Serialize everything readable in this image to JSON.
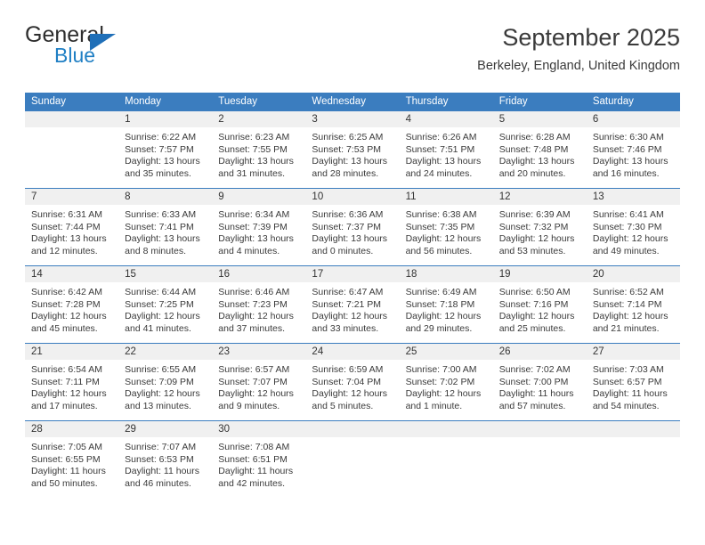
{
  "brand": {
    "name_part1": "General",
    "name_part2": "Blue",
    "logo_icon": "blue-triangle-icon"
  },
  "header": {
    "title": "September 2025",
    "location": "Berkeley, England, United Kingdom"
  },
  "colors": {
    "header_blue": "#3b7dbf",
    "brand_blue": "#1f7fc4",
    "daynum_band": "#f0f0f0",
    "text": "#3a3a3a"
  },
  "calendar": {
    "weekdays": [
      "Sunday",
      "Monday",
      "Tuesday",
      "Wednesday",
      "Thursday",
      "Friday",
      "Saturday"
    ],
    "weeks": [
      [
        {
          "day": "",
          "empty": true,
          "sunrise": "",
          "sunset": "",
          "daylight_a": "",
          "daylight_b": ""
        },
        {
          "day": "1",
          "sunrise": "Sunrise: 6:22 AM",
          "sunset": "Sunset: 7:57 PM",
          "daylight_a": "Daylight: 13 hours",
          "daylight_b": "and 35 minutes."
        },
        {
          "day": "2",
          "sunrise": "Sunrise: 6:23 AM",
          "sunset": "Sunset: 7:55 PM",
          "daylight_a": "Daylight: 13 hours",
          "daylight_b": "and 31 minutes."
        },
        {
          "day": "3",
          "sunrise": "Sunrise: 6:25 AM",
          "sunset": "Sunset: 7:53 PM",
          "daylight_a": "Daylight: 13 hours",
          "daylight_b": "and 28 minutes."
        },
        {
          "day": "4",
          "sunrise": "Sunrise: 6:26 AM",
          "sunset": "Sunset: 7:51 PM",
          "daylight_a": "Daylight: 13 hours",
          "daylight_b": "and 24 minutes."
        },
        {
          "day": "5",
          "sunrise": "Sunrise: 6:28 AM",
          "sunset": "Sunset: 7:48 PM",
          "daylight_a": "Daylight: 13 hours",
          "daylight_b": "and 20 minutes."
        },
        {
          "day": "6",
          "sunrise": "Sunrise: 6:30 AM",
          "sunset": "Sunset: 7:46 PM",
          "daylight_a": "Daylight: 13 hours",
          "daylight_b": "and 16 minutes."
        }
      ],
      [
        {
          "day": "7",
          "sunrise": "Sunrise: 6:31 AM",
          "sunset": "Sunset: 7:44 PM",
          "daylight_a": "Daylight: 13 hours",
          "daylight_b": "and 12 minutes."
        },
        {
          "day": "8",
          "sunrise": "Sunrise: 6:33 AM",
          "sunset": "Sunset: 7:41 PM",
          "daylight_a": "Daylight: 13 hours",
          "daylight_b": "and 8 minutes."
        },
        {
          "day": "9",
          "sunrise": "Sunrise: 6:34 AM",
          "sunset": "Sunset: 7:39 PM",
          "daylight_a": "Daylight: 13 hours",
          "daylight_b": "and 4 minutes."
        },
        {
          "day": "10",
          "sunrise": "Sunrise: 6:36 AM",
          "sunset": "Sunset: 7:37 PM",
          "daylight_a": "Daylight: 13 hours",
          "daylight_b": "and 0 minutes."
        },
        {
          "day": "11",
          "sunrise": "Sunrise: 6:38 AM",
          "sunset": "Sunset: 7:35 PM",
          "daylight_a": "Daylight: 12 hours",
          "daylight_b": "and 56 minutes."
        },
        {
          "day": "12",
          "sunrise": "Sunrise: 6:39 AM",
          "sunset": "Sunset: 7:32 PM",
          "daylight_a": "Daylight: 12 hours",
          "daylight_b": "and 53 minutes."
        },
        {
          "day": "13",
          "sunrise": "Sunrise: 6:41 AM",
          "sunset": "Sunset: 7:30 PM",
          "daylight_a": "Daylight: 12 hours",
          "daylight_b": "and 49 minutes."
        }
      ],
      [
        {
          "day": "14",
          "sunrise": "Sunrise: 6:42 AM",
          "sunset": "Sunset: 7:28 PM",
          "daylight_a": "Daylight: 12 hours",
          "daylight_b": "and 45 minutes."
        },
        {
          "day": "15",
          "sunrise": "Sunrise: 6:44 AM",
          "sunset": "Sunset: 7:25 PM",
          "daylight_a": "Daylight: 12 hours",
          "daylight_b": "and 41 minutes."
        },
        {
          "day": "16",
          "sunrise": "Sunrise: 6:46 AM",
          "sunset": "Sunset: 7:23 PM",
          "daylight_a": "Daylight: 12 hours",
          "daylight_b": "and 37 minutes."
        },
        {
          "day": "17",
          "sunrise": "Sunrise: 6:47 AM",
          "sunset": "Sunset: 7:21 PM",
          "daylight_a": "Daylight: 12 hours",
          "daylight_b": "and 33 minutes."
        },
        {
          "day": "18",
          "sunrise": "Sunrise: 6:49 AM",
          "sunset": "Sunset: 7:18 PM",
          "daylight_a": "Daylight: 12 hours",
          "daylight_b": "and 29 minutes."
        },
        {
          "day": "19",
          "sunrise": "Sunrise: 6:50 AM",
          "sunset": "Sunset: 7:16 PM",
          "daylight_a": "Daylight: 12 hours",
          "daylight_b": "and 25 minutes."
        },
        {
          "day": "20",
          "sunrise": "Sunrise: 6:52 AM",
          "sunset": "Sunset: 7:14 PM",
          "daylight_a": "Daylight: 12 hours",
          "daylight_b": "and 21 minutes."
        }
      ],
      [
        {
          "day": "21",
          "sunrise": "Sunrise: 6:54 AM",
          "sunset": "Sunset: 7:11 PM",
          "daylight_a": "Daylight: 12 hours",
          "daylight_b": "and 17 minutes."
        },
        {
          "day": "22",
          "sunrise": "Sunrise: 6:55 AM",
          "sunset": "Sunset: 7:09 PM",
          "daylight_a": "Daylight: 12 hours",
          "daylight_b": "and 13 minutes."
        },
        {
          "day": "23",
          "sunrise": "Sunrise: 6:57 AM",
          "sunset": "Sunset: 7:07 PM",
          "daylight_a": "Daylight: 12 hours",
          "daylight_b": "and 9 minutes."
        },
        {
          "day": "24",
          "sunrise": "Sunrise: 6:59 AM",
          "sunset": "Sunset: 7:04 PM",
          "daylight_a": "Daylight: 12 hours",
          "daylight_b": "and 5 minutes."
        },
        {
          "day": "25",
          "sunrise": "Sunrise: 7:00 AM",
          "sunset": "Sunset: 7:02 PM",
          "daylight_a": "Daylight: 12 hours",
          "daylight_b": "and 1 minute."
        },
        {
          "day": "26",
          "sunrise": "Sunrise: 7:02 AM",
          "sunset": "Sunset: 7:00 PM",
          "daylight_a": "Daylight: 11 hours",
          "daylight_b": "and 57 minutes."
        },
        {
          "day": "27",
          "sunrise": "Sunrise: 7:03 AM",
          "sunset": "Sunset: 6:57 PM",
          "daylight_a": "Daylight: 11 hours",
          "daylight_b": "and 54 minutes."
        }
      ],
      [
        {
          "day": "28",
          "sunrise": "Sunrise: 7:05 AM",
          "sunset": "Sunset: 6:55 PM",
          "daylight_a": "Daylight: 11 hours",
          "daylight_b": "and 50 minutes."
        },
        {
          "day": "29",
          "sunrise": "Sunrise: 7:07 AM",
          "sunset": "Sunset: 6:53 PM",
          "daylight_a": "Daylight: 11 hours",
          "daylight_b": "and 46 minutes."
        },
        {
          "day": "30",
          "sunrise": "Sunrise: 7:08 AM",
          "sunset": "Sunset: 6:51 PM",
          "daylight_a": "Daylight: 11 hours",
          "daylight_b": "and 42 minutes."
        },
        {
          "day": "",
          "empty": true,
          "sunrise": "",
          "sunset": "",
          "daylight_a": "",
          "daylight_b": ""
        },
        {
          "day": "",
          "empty": true,
          "sunrise": "",
          "sunset": "",
          "daylight_a": "",
          "daylight_b": ""
        },
        {
          "day": "",
          "empty": true,
          "sunrise": "",
          "sunset": "",
          "daylight_a": "",
          "daylight_b": ""
        },
        {
          "day": "",
          "empty": true,
          "sunrise": "",
          "sunset": "",
          "daylight_a": "",
          "daylight_b": ""
        }
      ]
    ]
  }
}
